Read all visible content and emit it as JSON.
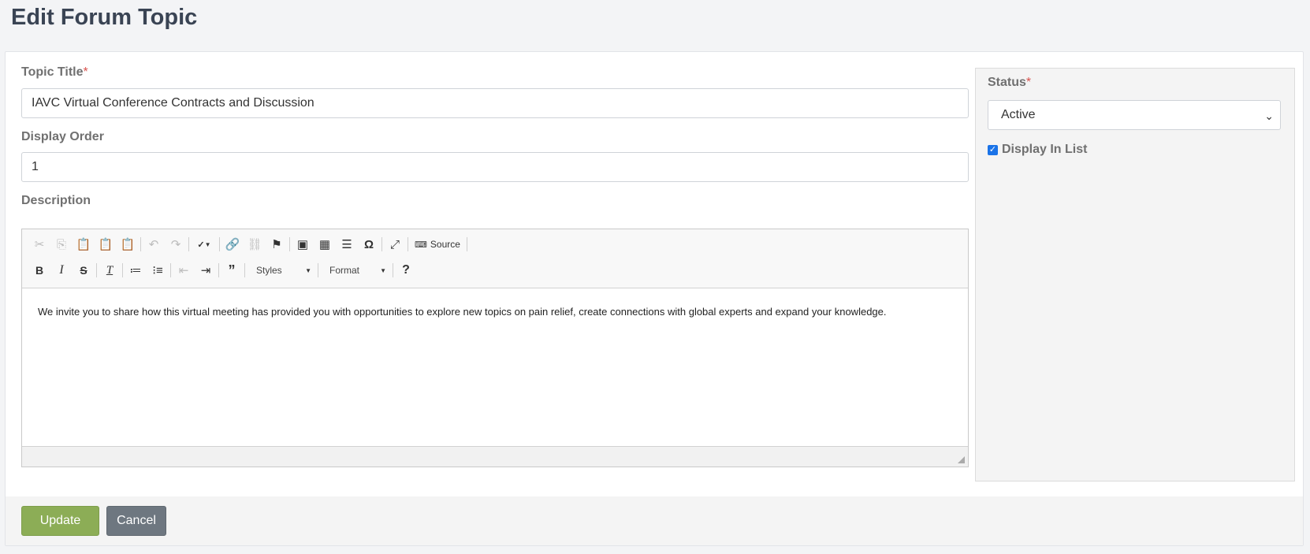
{
  "page": {
    "title": "Edit Forum Topic"
  },
  "form": {
    "topic_title": {
      "label": "Topic Title",
      "required_mark": "*",
      "value": "IAVC Virtual Conference Contracts and Discussion"
    },
    "display_order": {
      "label": "Display Order",
      "value": "1"
    },
    "description": {
      "label": "Description",
      "content": "We invite you to share how this virtual meeting has provided you with opportunities to explore new topics on pain relief, create connections with global experts and expand your knowledge.",
      "toolbar": {
        "row1": [
          "cut-icon",
          "copy-icon",
          "paste-icon",
          "paste-text-icon",
          "paste-word-icon",
          "undo-icon",
          "redo-icon",
          "spellcheck-icon",
          "link-icon",
          "unlink-icon",
          "anchor-icon",
          "image-icon",
          "table-icon",
          "horizontal-line-icon",
          "special-char-icon",
          "maximize-icon",
          "source-icon"
        ],
        "source_label": "Source",
        "row2": [
          "bold-icon",
          "italic-icon",
          "strikethrough-icon",
          "remove-format-icon",
          "numbered-list-icon",
          "bulleted-list-icon",
          "outdent-icon",
          "indent-icon",
          "blockquote-icon",
          "help-icon"
        ],
        "styles_label": "Styles",
        "format_label": "Format"
      }
    }
  },
  "sidebar": {
    "status": {
      "label": "Status",
      "required_mark": "*",
      "selected": "Active"
    },
    "display_in_list": {
      "label": "Display In List",
      "checked": true
    }
  },
  "actions": {
    "update_label": "Update",
    "cancel_label": "Cancel"
  },
  "colors": {
    "update": "#8cad56",
    "cancel": "#6e7780",
    "title": "#3a4454",
    "required": "#d9534f"
  }
}
